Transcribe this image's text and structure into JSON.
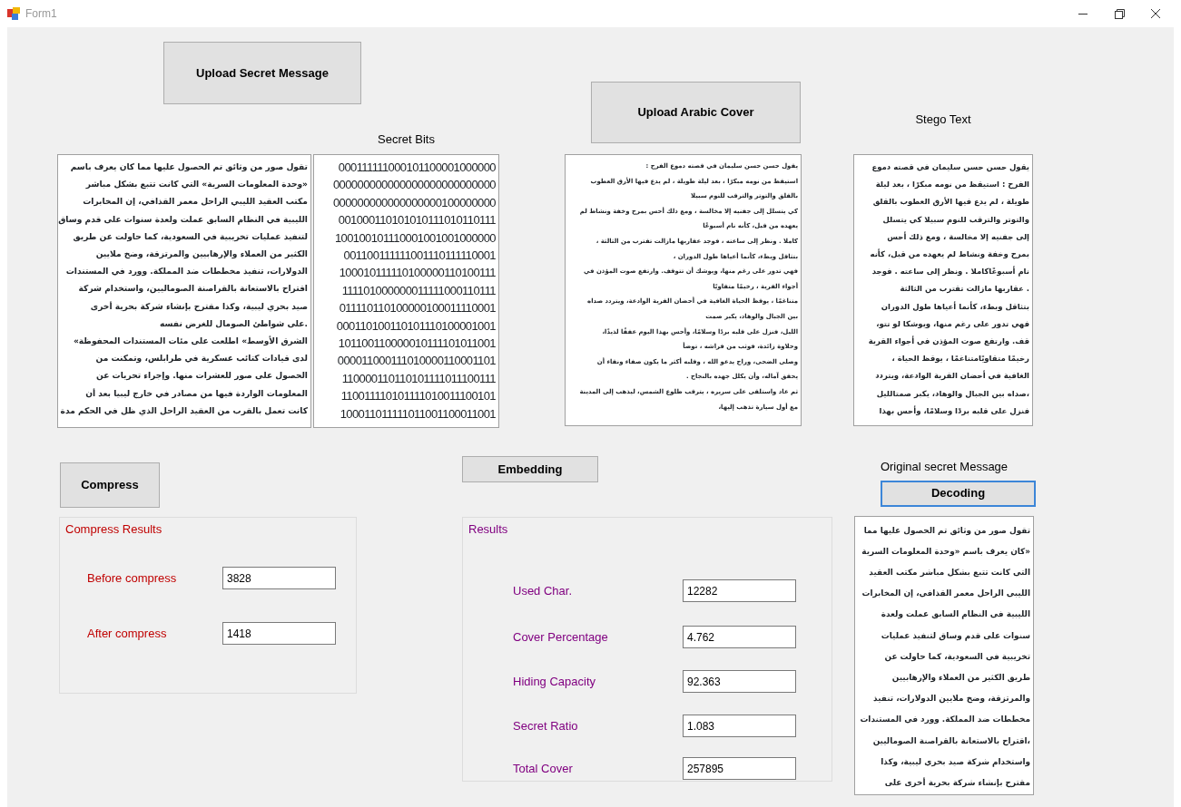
{
  "window": {
    "title": "Form1"
  },
  "upload_secret_button": {
    "label": "Upload Secret Message",
    "focused": false
  },
  "secret_message_box": {
    "lines": [
      "تقول صور من وثائق تم الحصول عليها مما كان يعرف باسم",
      "«وحدة المعلومات السرية» التي كانت تتبع بشكل مباشر",
      "مكتب العقيد الليبي الراحل معمر القذافي، إن المخابرات",
      "الليبية في النظام السابق عملت ولعدة سنوات على قدم وساق",
      "لتنفيذ عمليات تخريبية في السعودية، كما حاولت عن طريق",
      "الكثير من العملاء والإرهابيين والمرتزقة، وضخ ملايين",
      "الدولارات، تنفيذ مخططات ضد المملكة. وورد في المستندات",
      "اقتراح بالاستعانة بالقراصنة الصوماليين، واستخدام شركة",
      "صيد بحري ليبية، وكذا مقترح بإنشاء شركة بحرية أخرى",
      ".على شواطئ الصومال للغرض نفسه",
      "الشرق الأوسط» اطلعت على مئات المستندات المحفوظة»",
      "لدى قيادات كتائب عسكرية في طرابلس، وتمكنت من",
      "الحصول على صور للعشرات منها. وإجراء تحريات عن",
      "المعلومات الواردة فيها من مصادر في خارج ليبيا بعد أن",
      "كانت تعمل بالقرب من العقيد الراحل الذي ظل في الحكم مدة"
    ]
  },
  "secret_bits": {
    "label": "Secret Bits",
    "lines": [
      "000111111000101100001000000",
      "000000000000000000000000000",
      "000000000000000000100000000",
      "001000110101010111010110111",
      "100100101110001001001000000",
      "001100111111001110111110001",
      "100010111110100000110100111",
      "111101000000011111000110111",
      "011110110100000100011110001",
      "000110100110101110100001001",
      "101100110000010111101011001",
      "000011000111010000110001101",
      "110000110110101111011100111",
      "110011110101111010011100101",
      "100011011111011001100011001"
    ]
  },
  "upload_cover_button": {
    "label": "Upload Arabic Cover",
    "focused": false
  },
  "cover_box": {
    "lines": [
      "يقول حسن حسن سليمان في قصته دموع الفرح :",
      "استيقظ من نومه مبكرًا ، بعد ليلة طويلة ، لم يدع فيها الأرق العطوب",
      "بالقلق والتوتر والترقب للنوم سبيلا",
      "كي يتسلل إلى جفنيه إلا مخالسة ، ومع ذلك أحس بمرح وخفة ونشاط لم",
      "يعهده من قبل، كأنه نام أسبوعًا",
      "كاملا . ونظر إلى ساعته ، فوجد عقاربها مازالت تقترب من الثالثة ،",
      "بتثاقل وبطء، كأنما أعياها طول الدوران ،",
      "فهي تدور على رغم منها، ويوشك أن تتوقف. وارتفع صوت المؤذن في",
      "أجواء القرية ، رخيمًا متقاويًا",
      "متناغمًا ، يوقظ الحياة الغافية في أحضان القرية الوادعة، ويتردد صداه",
      "بين الجبال والوهاد، يكبر صمت",
      "الليل، فنزل على قلبه بردًا وسلامًا، وأحس بهذا اليوم عفقًا لذيذًا،",
      "وحلاوة زائدة، فوثب من فراشه ، توضأ",
      "وصلى الضحى، وراح يدعو الله ، وقلبه أكثر ما يكون صفاء ونقاء أن",
      "يحقق آماله، وأن يكلل جهده بالنجاح .",
      "ثم عاد واستلقى على سريره ، يترقب طلوع الشمس، ليذهب إلى المدينة",
      "مع أول سيارة تذهب إليها،"
    ]
  },
  "stego": {
    "label": "Stego Text",
    "lines": [
      "يقول حسن حسن سليمان في قصته دموع",
      "الفرح : استيقظ من نومه مبكرًا ، بعد ليلة",
      "طويلة ، لم يدع فيها الأرق العطوب بالقلق",
      "والتوتر والترقب للنوم سبيلا كي يتسلل",
      "إلى جفنيه إلا مخالسة ، ومع ذلك أحس",
      "بمرح وخفة ونشاط لم يعهده من قبل، كأنه",
      "نام أسبوعًاكاملا . ونظر إلى ساعته . فوجد",
      ". عقاربها مازالت تقترب من الثالثة",
      "بتثاقل وبطء، كأنما أعياها طول الدوران",
      "فهي تدور على رغم منها، ويوشكا لو تتو،",
      "قف. وارتفع صوت المؤذن في أجواء القرية",
      "رخيمًا متقاويًامتناغمًا ، يوقظ الحياة ،",
      "الغافية في أحضان القرية الوادعة، ويتردد",
      "،صداه بين الجبال والوهاد، يكبر صمتالليل",
      "فنزل على قلبه بردًا وسلامًا، وأحس بهذا"
    ]
  },
  "compress_button": {
    "label": "Compress",
    "focused": false
  },
  "compress_results": {
    "title": "Compress Results",
    "fields": [
      {
        "label": "Before compress",
        "value": "3828"
      },
      {
        "label": "After compress",
        "value": "1418"
      }
    ]
  },
  "embedding_button": {
    "label": "Embedding",
    "focused": false
  },
  "results": {
    "title": "Results",
    "fields": [
      {
        "label": "Used Char.",
        "value": "12282"
      },
      {
        "label": "Cover Percentage",
        "value": "4.762"
      },
      {
        "label": "Hiding Capacity",
        "value": "92.363"
      },
      {
        "label": "Secret Ratio",
        "value": "1.083"
      },
      {
        "label": "Total Cover",
        "value": "257895"
      }
    ]
  },
  "decoding": {
    "label": "Original secret Message",
    "button": {
      "label": "Decoding",
      "focused": true
    },
    "lines": [
      "تقول صور من وثائق تم الحصول عليها مما",
      "«كان يعرف باسم «وحدة المعلومات السرية",
      "التي كانت تتبع بشكل مباشر مكتب العقيد",
      "الليبي الراحل معمر القذافي، إن المخابرات",
      "الليبية في النظام السابق عملت ولعدة",
      "سنوات على قدم وساق لتنفيذ عمليات",
      "تخريبية في السعودية، كما حاولت عن",
      "طريق الكثير من العملاء والإرهابيين",
      "والمرتزقة، وضخ ملايين الدولارات، تنفيذ",
      "مخططات ضد المملكة. وورد في المستندات",
      "،اقتراح بالاستعانة بالقراصنة الصوماليين",
      "واستخدام شركة صيد بحري ليبية، وكذا",
      "مقترح بإنشاء شركة بحرية أخرى على"
    ]
  }
}
